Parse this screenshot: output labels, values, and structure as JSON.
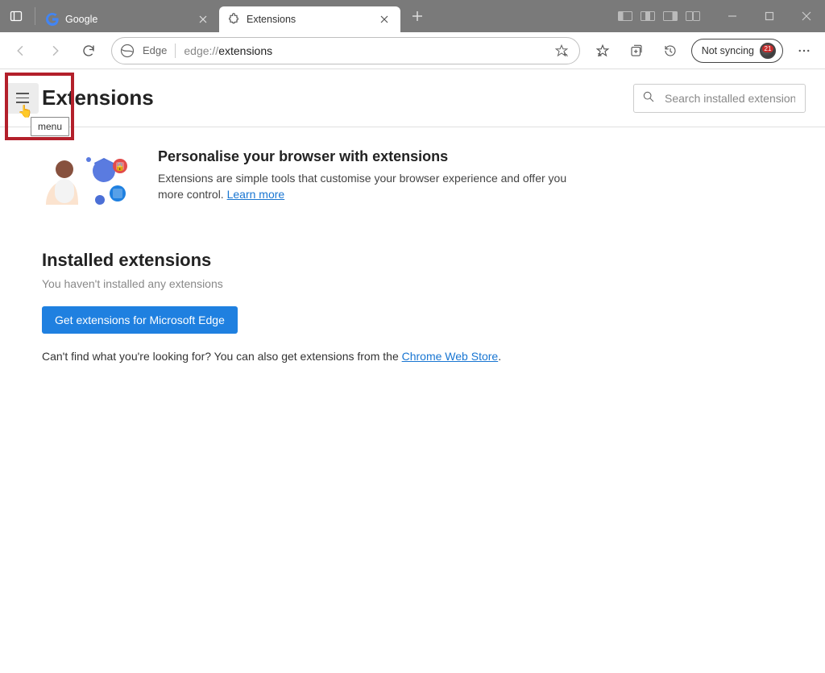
{
  "titlebar": {
    "tabs": [
      {
        "title": "Google",
        "active": false
      },
      {
        "title": "Extensions",
        "active": true
      }
    ]
  },
  "toolbar": {
    "identity_label": "Edge",
    "url_prefix": "edge://",
    "url_strong": "extensions",
    "sync_label": "Not syncing",
    "sync_badge_count": "21"
  },
  "header": {
    "page_title": "Extensions",
    "menu_tooltip": "menu",
    "search_placeholder": "Search installed extensions"
  },
  "hero": {
    "heading": "Personalise your browser with extensions",
    "body": "Extensions are simple tools that customise your browser experience and offer you more control. ",
    "learn_more": "Learn more"
  },
  "installed": {
    "heading": "Installed extensions",
    "empty_text": "You haven't installed any extensions",
    "cta_label": "Get extensions for Microsoft Edge",
    "below_prefix": "Can't find what you're looking for? You can also get extensions from the ",
    "below_link": "Chrome Web Store",
    "below_suffix": "."
  }
}
